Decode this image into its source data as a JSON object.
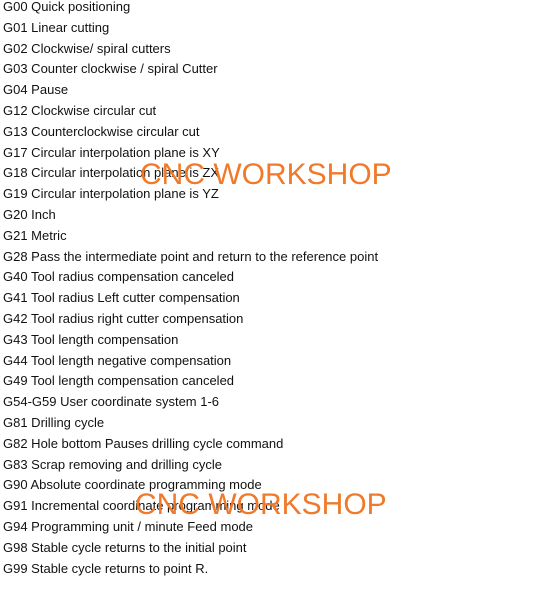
{
  "codes": [
    "G00 Quick positioning",
    "G01 Linear cutting",
    "G02 Clockwise/ spiral cutters",
    "G03 Counter clockwise / spiral Cutter",
    "G04 Pause",
    "G12 Clockwise circular cut",
    "G13 Counterclockwise circular cut",
    "G17 Circular interpolation plane is XY",
    "G18 Circular interpolation plane is ZX",
    "G19 Circular interpolation plane is YZ",
    "G20 Inch",
    "G21 Metric",
    "G28 Pass the intermediate point and return to the reference point",
    "G40 Tool radius compensation canceled",
    "G41 Tool radius Left cutter compensation",
    "G42 Tool radius right cutter compensation",
    "G43 Tool length compensation",
    "G44 Tool length negative compensation",
    "G49 Tool length compensation canceled",
    "G54-G59 User coordinate system 1-6",
    "G81 Drilling cycle",
    "G82 Hole bottom Pauses drilling cycle command",
    "G83 Scrap removing and drilling cycle",
    "G90 Absolute coordinate programming mode",
    "G91 Incremental coordinate programming mode",
    "G94 Programming unit / minute Feed mode",
    "G98 Stable cycle returns to the initial point",
    "G99 Stable cycle returns to point R."
  ],
  "watermark": {
    "text": "CNC WORKSHOP",
    "color": "#f07a2a"
  }
}
